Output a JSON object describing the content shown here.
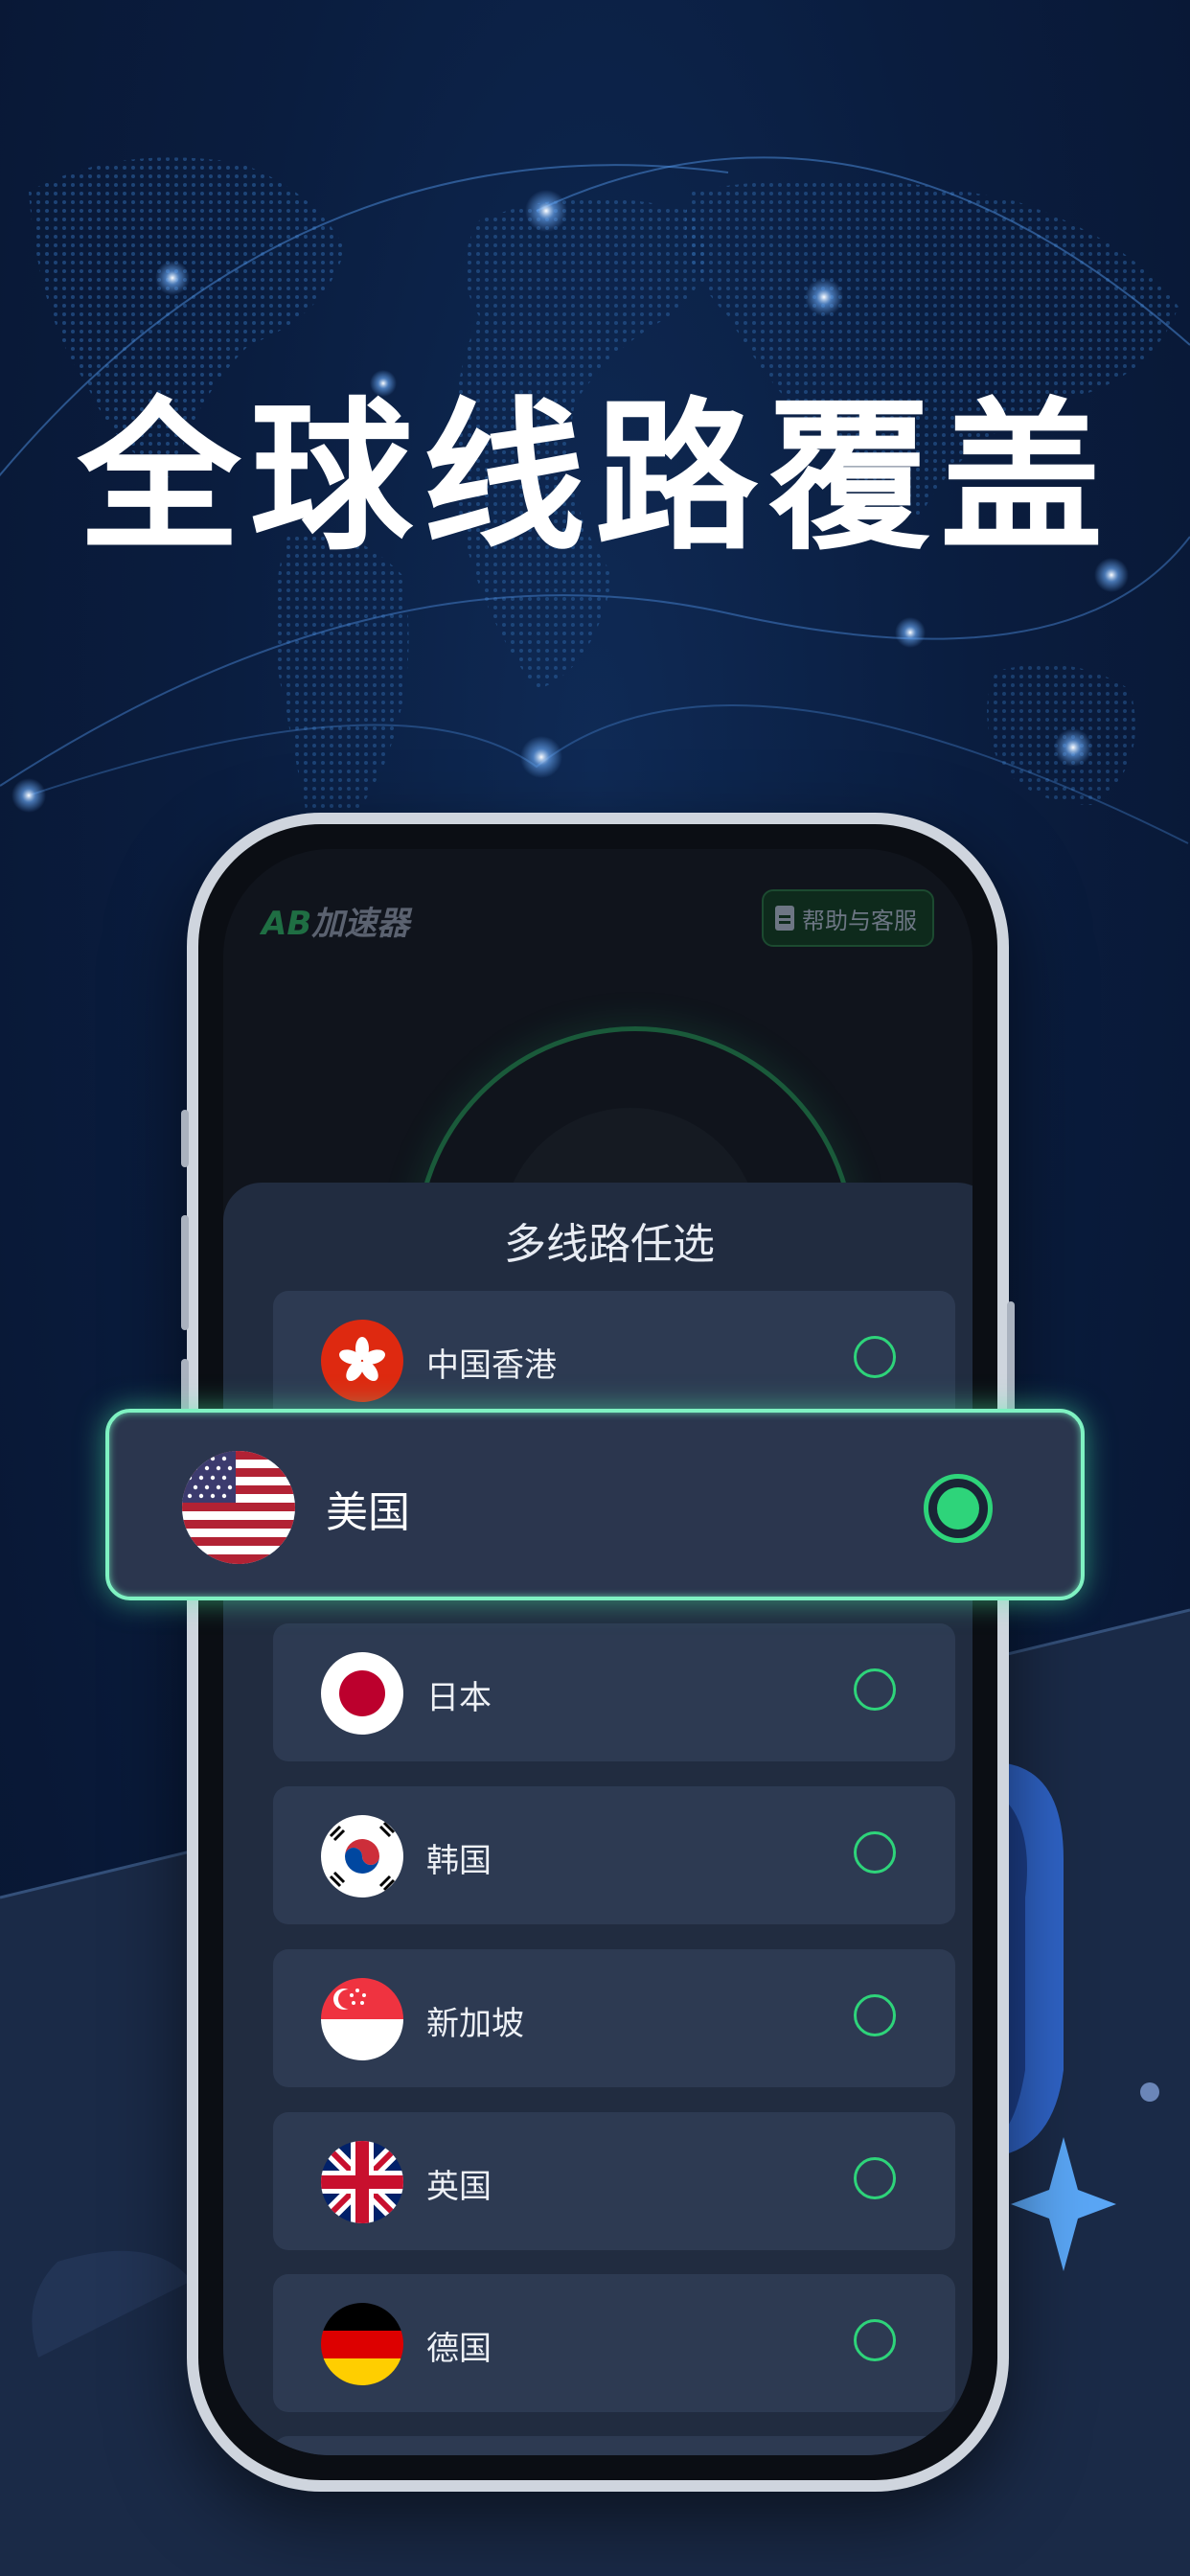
{
  "headline": "全球线路覆盖",
  "app": {
    "logo_ab": "AB",
    "logo_name": "加速器",
    "help_label": "帮助与客服"
  },
  "sheet": {
    "title": "多线路任选"
  },
  "highlight": {
    "label": "美国",
    "flag": "us-flag-icon",
    "selected": true
  },
  "regions": [
    {
      "label": "中国香港",
      "flag": "hk-flag-icon",
      "selected": false
    },
    {
      "label": "日本",
      "flag": "jp-flag-icon",
      "selected": false
    },
    {
      "label": "韩国",
      "flag": "kr-flag-icon",
      "selected": false
    },
    {
      "label": "新加坡",
      "flag": "sg-flag-icon",
      "selected": false
    },
    {
      "label": "英国",
      "flag": "uk-flag-icon",
      "selected": false
    },
    {
      "label": "德国",
      "flag": "de-flag-icon",
      "selected": false
    }
  ],
  "colors": {
    "accent": "#2ed47a",
    "background": "#0a1d3f",
    "sheet": "#212c40",
    "row": "#2d3a52"
  }
}
